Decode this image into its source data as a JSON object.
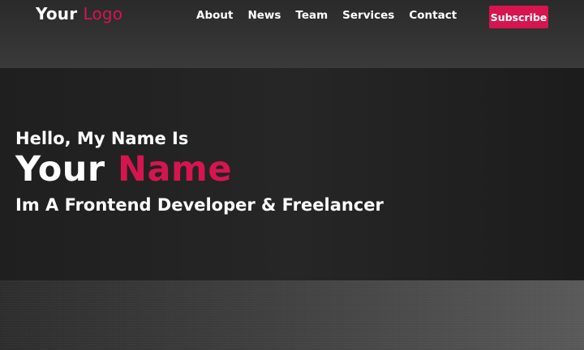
{
  "logo": {
    "part1": "Your",
    "part2": "Logo"
  },
  "nav": {
    "items": [
      {
        "label": "About"
      },
      {
        "label": "News"
      },
      {
        "label": "Team"
      },
      {
        "label": "Services"
      },
      {
        "label": "Contact"
      }
    ],
    "subscribe_label": "Subscribe"
  },
  "hero": {
    "greeting": "Hello, My Name Is",
    "name_part1": "Your",
    "name_part2": "Name",
    "tagline": "Im A Frontend Developer & Freelancer"
  },
  "colors": {
    "accent": "#d6154f",
    "text": "#ffffff",
    "hero_bg": "#222222",
    "page_bg": "#3c3c3c"
  }
}
